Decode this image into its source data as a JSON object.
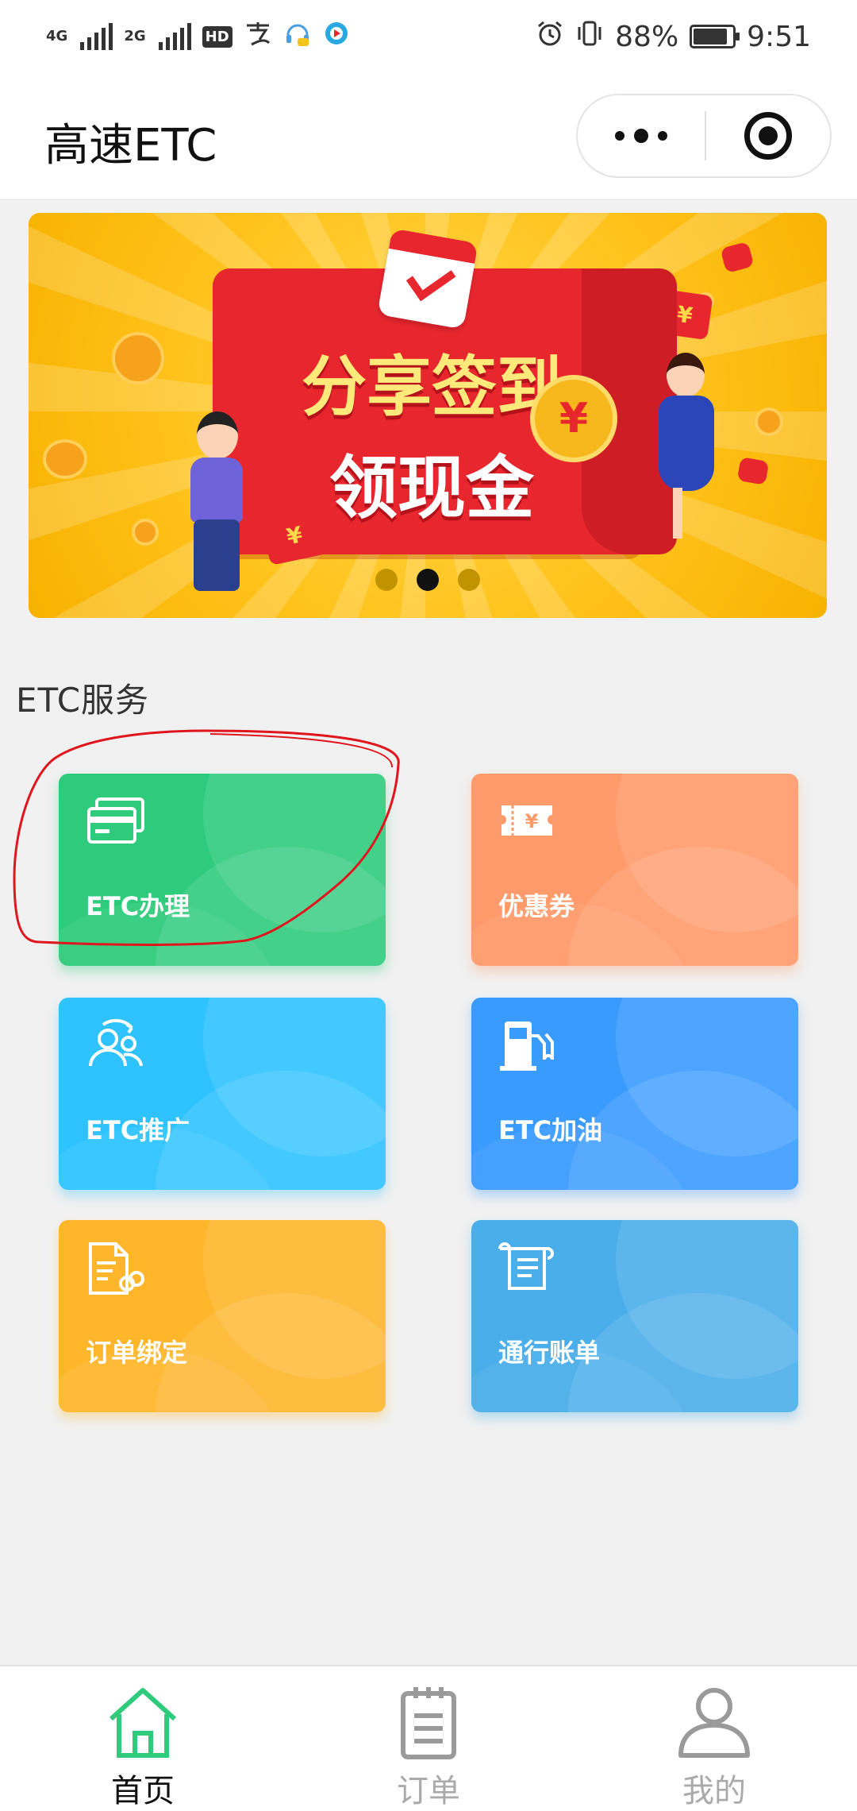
{
  "status_bar": {
    "network_1": "4G",
    "network_2": "2G",
    "hd": "HD",
    "battery": "88%",
    "battery_level": 0.88,
    "time": "9:51",
    "icons": [
      "signal-icon",
      "alipay-icon",
      "headset-icon",
      "app-icon",
      "alarm-icon",
      "vibrate-icon",
      "battery-icon"
    ]
  },
  "header": {
    "title": "高速ETC",
    "more_icon": "more-dots-icon",
    "close_icon": "target-icon"
  },
  "banner": {
    "line1": "分享签到",
    "line2": "领现金",
    "coin_glyph": "¥",
    "slide_count": 3,
    "active_slide": 2,
    "colors": {
      "background": "#ffc21b",
      "envelope": "#e8262e"
    }
  },
  "section": {
    "title": "ETC服务"
  },
  "services": [
    {
      "label": "ETC办理",
      "icon": "card-icon",
      "color": "#2ecb7c"
    },
    {
      "label": "优惠券",
      "icon": "coupon-icon",
      "color": "#ff9a6a"
    },
    {
      "label": "ETC推广",
      "icon": "people-icon",
      "color": "#2ec3ff"
    },
    {
      "label": "ETC加油",
      "icon": "fuel-pump-icon",
      "color": "#3a9bff"
    },
    {
      "label": "订单绑定",
      "icon": "document-link-icon",
      "color": "#ffb62b"
    },
    {
      "label": "通行账单",
      "icon": "bill-icon",
      "color": "#4aaeea"
    }
  ],
  "tabbar": {
    "tabs": [
      {
        "label": "首页",
        "icon": "home-icon",
        "active": true
      },
      {
        "label": "订单",
        "icon": "clipboard-icon",
        "active": false
      },
      {
        "label": "我的",
        "icon": "user-icon",
        "active": false
      }
    ],
    "active_color": "#2ecb7c"
  }
}
